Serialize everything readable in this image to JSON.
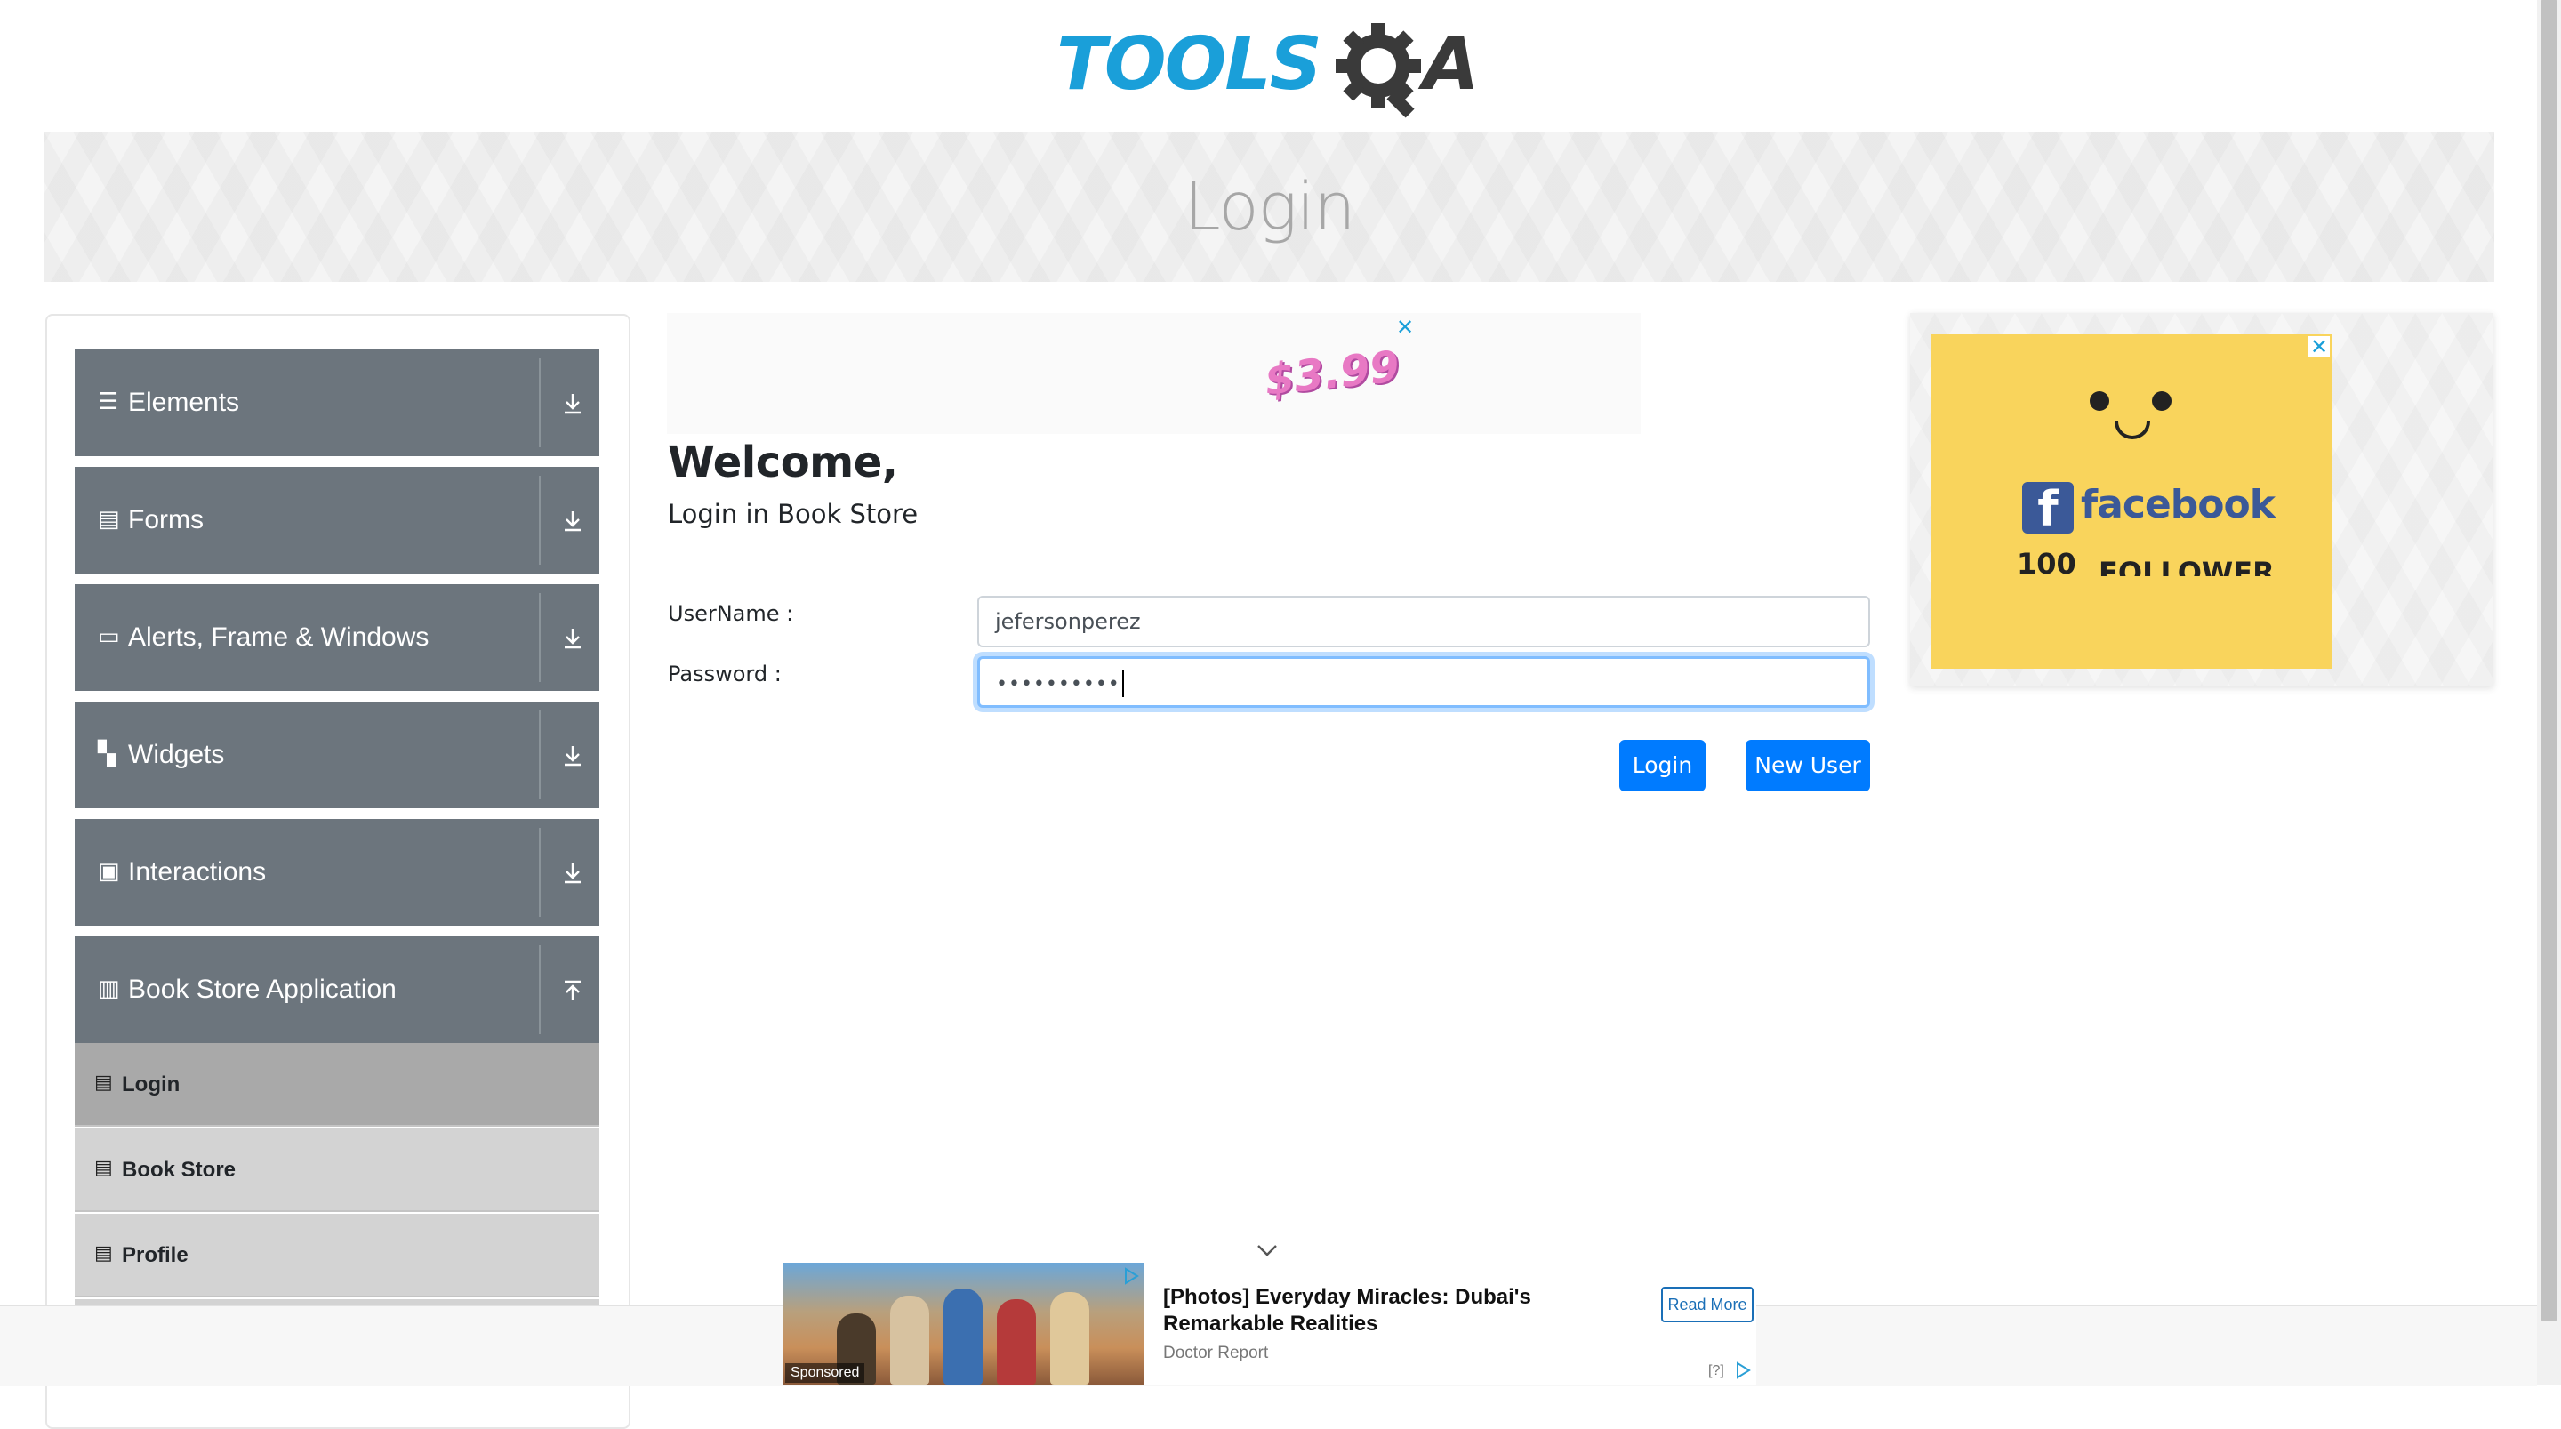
{
  "header": {
    "logo_left": "TOOLS",
    "logo_right": "A",
    "page_title": "Login"
  },
  "sidebar": {
    "groups": [
      {
        "label": "Elements",
        "icon": "list-icon"
      },
      {
        "label": "Forms",
        "icon": "document-icon"
      },
      {
        "label": "Alerts, Frame & Windows",
        "icon": "window-icon"
      },
      {
        "label": "Widgets",
        "icon": "widgets-icon"
      },
      {
        "label": "Interactions",
        "icon": "interactions-icon"
      },
      {
        "label": "Book Store Application",
        "icon": "books-icon"
      }
    ],
    "book_store_items": [
      {
        "label": "Login",
        "active": true
      },
      {
        "label": "Book Store",
        "active": false
      },
      {
        "label": "Profile",
        "active": false
      }
    ]
  },
  "top_ad": {
    "price": "$3.99",
    "close": "✕"
  },
  "login_form": {
    "heading": "Welcome,",
    "subheading": "Login in Book Store",
    "username_label": "UserName :",
    "username_value": "jefersonperez",
    "password_label": "Password :",
    "password_value": "••••••••••",
    "login_button": "Login",
    "new_user_button": "New User"
  },
  "right_ad": {
    "brand": "facebook",
    "fb_letter": "f",
    "count": "100",
    "follower": "FOLLOWER",
    "close": "✕"
  },
  "sponsored": {
    "title": "[Photos] Everyday Miracles: Dubai's Remarkable Realities",
    "source": "Doctor Report",
    "cta": "Read More",
    "tag": "Sponsored",
    "help": "[?]"
  },
  "colors": {
    "primary": "#007bff",
    "sidebar_group": "#6c757d",
    "sidebar_sub": "#d3d3d3",
    "sidebar_sub_active": "#a9a9a9",
    "logo_blue": "#1a9fd9",
    "fb_blue": "#3b5998",
    "ad_yellow": "#f9d45c"
  }
}
